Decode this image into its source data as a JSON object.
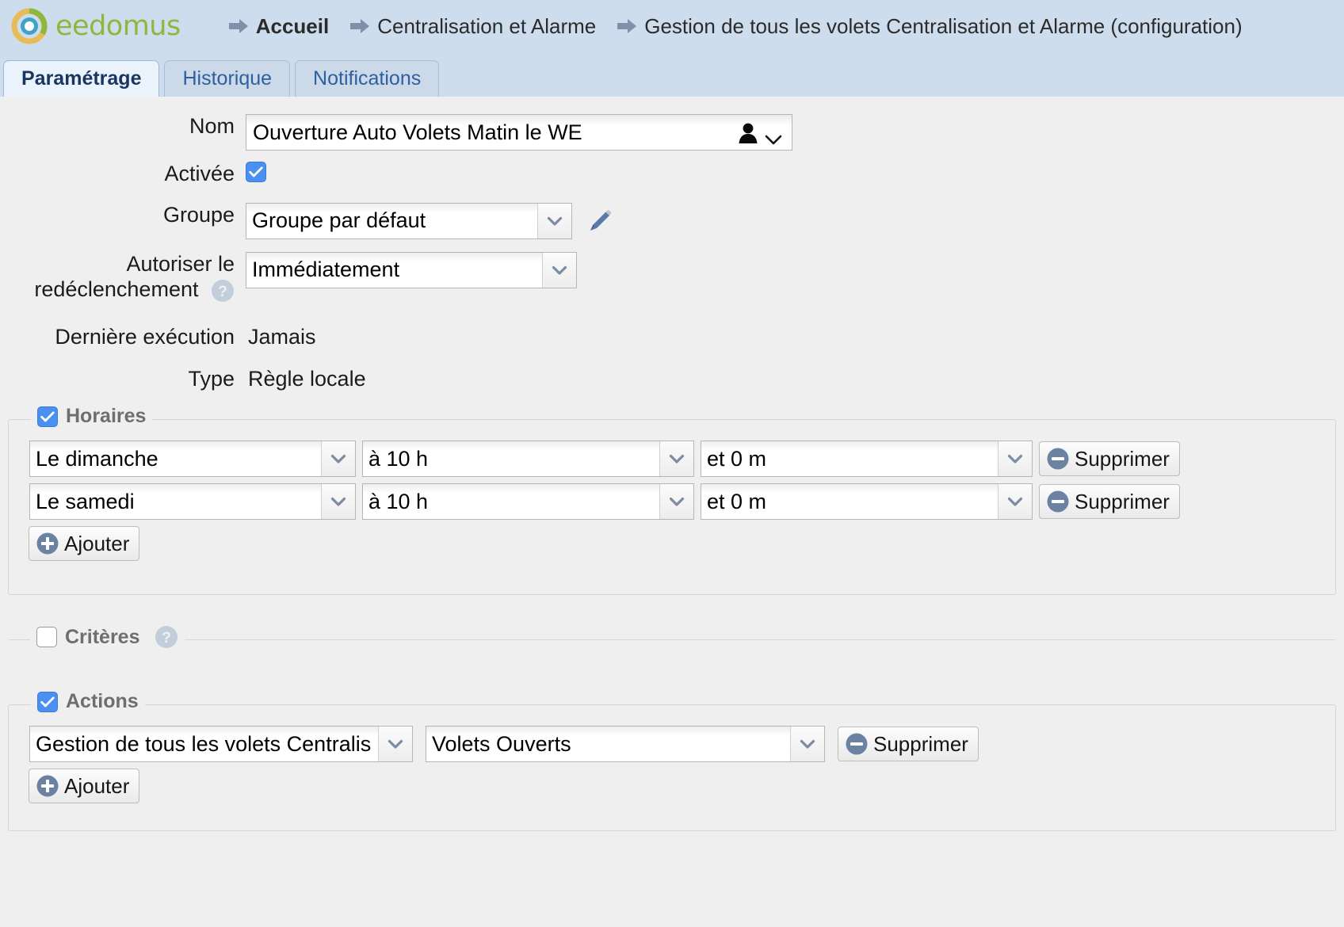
{
  "brand": {
    "name": "eedomus",
    "logo_icon": "eedomus-ring-logo",
    "green": "#8fb73e",
    "gold": "#e8bb55",
    "blue": "#3fa3c4"
  },
  "header": {
    "breadcrumb": [
      {
        "label": "Accueil",
        "icon": "arrow-right-icon",
        "bold": true
      },
      {
        "label": "Centralisation et Alarme",
        "icon": "arrow-right-icon",
        "bold": false
      },
      {
        "label": "Gestion de tous les volets Centralisation et Alarme (configuration)",
        "icon": "arrow-right-icon",
        "bold": false
      }
    ]
  },
  "tabs": [
    {
      "label": "Paramétrage",
      "active": true
    },
    {
      "label": "Historique",
      "active": false
    },
    {
      "label": "Notifications",
      "active": false
    }
  ],
  "form": {
    "nom": {
      "label": "Nom",
      "value": "Ouverture Auto Volets Matin le WE",
      "placeholder": "",
      "person_icon": "person-icon",
      "chevron_icon": "chevron-down-icon"
    },
    "activee": {
      "label": "Activée",
      "checked": true
    },
    "groupe": {
      "label": "Groupe",
      "value": "Groupe par défaut",
      "edit_icon": "pencil-icon"
    },
    "redeclenchement": {
      "label_line1": "Autoriser le",
      "label_line2": "redéclenchement",
      "help_icon": "help-icon",
      "value": "Immédiatement"
    },
    "derniere_execution": {
      "label": "Dernière exécution",
      "value": "Jamais"
    },
    "type": {
      "label": "Type",
      "value": "Règle locale"
    }
  },
  "horaires": {
    "legend": "Horaires",
    "checked": true,
    "rows": [
      {
        "day": "Le dimanche",
        "hour": "à 10 h",
        "minute": "et 0 m",
        "delete_label": "Supprimer",
        "delete_icon": "minus-circle-icon"
      },
      {
        "day": "Le samedi",
        "hour": "à 10 h",
        "minute": "et 0 m",
        "delete_label": "Supprimer",
        "delete_icon": "minus-circle-icon"
      }
    ],
    "add_label": "Ajouter",
    "add_icon": "plus-circle-icon"
  },
  "criteres": {
    "legend": "Critères",
    "checked": false,
    "help_icon": "help-icon"
  },
  "actions": {
    "legend": "Actions",
    "checked": true,
    "rows": [
      {
        "target": "Gestion de tous les volets Centralis",
        "state": "Volets Ouverts",
        "delete_label": "Supprimer",
        "delete_icon": "minus-circle-icon"
      }
    ],
    "add_label": "Ajouter",
    "add_icon": "plus-circle-icon"
  }
}
